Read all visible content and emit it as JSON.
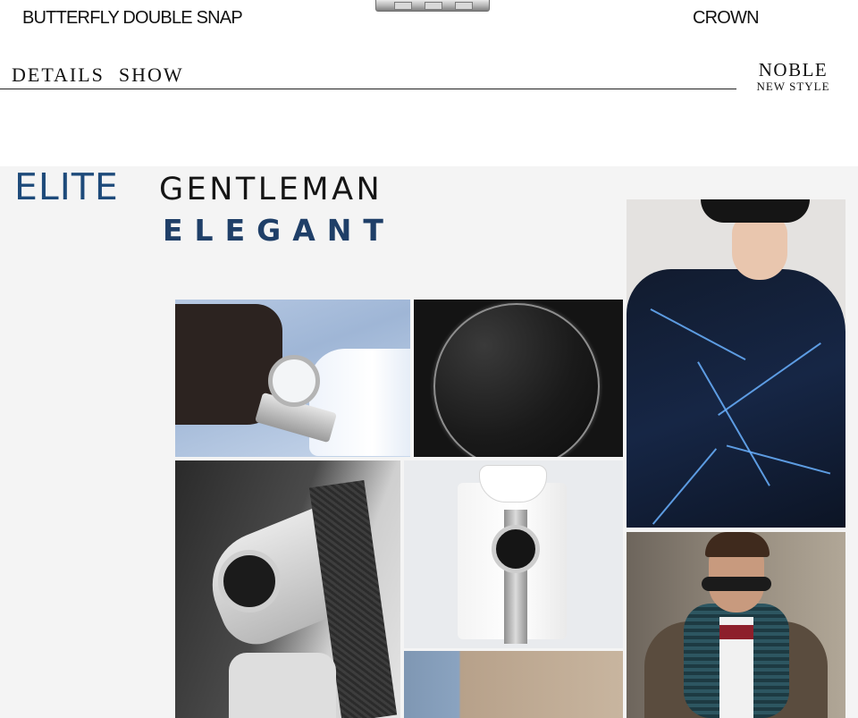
{
  "top_labels": {
    "left": "BUTTERFLY DOUBLE SNAP",
    "right": "CROWN"
  },
  "details_header": {
    "word1": "DETAILS",
    "word2": "SHOW",
    "badge_line1": "NOBLE",
    "badge_line2": "NEW STYLE"
  },
  "banner": {
    "elite": "ELITE",
    "gentleman": "GENTLEMAN",
    "elegant": "ELEGANT",
    "elite_color": "#1d4a7a",
    "elegant_color": "#1f3f68",
    "section_bg": "#f4f4f4"
  },
  "gallery": [
    "photo-watch-on-wrist",
    "photo-sapphire-crystal",
    "photo-bw-tie-and-watch",
    "photo-shirt-with-watch",
    "photo-denim-and-jacket",
    "photo-model-printed-tee",
    "photo-man-with-scarf"
  ]
}
